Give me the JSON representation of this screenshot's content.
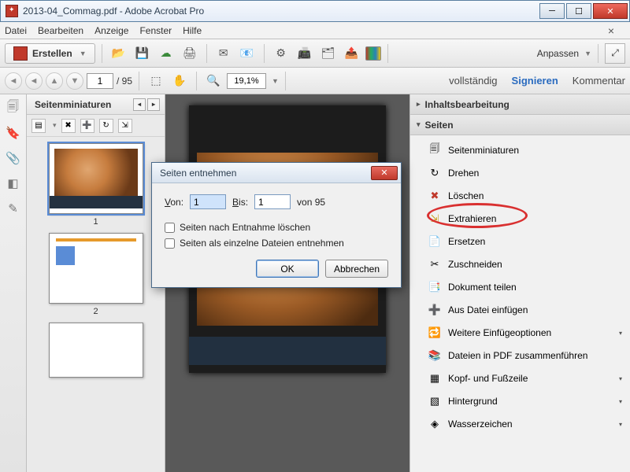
{
  "window": {
    "title": "2013-04_Commag.pdf - Adobe Acrobat Pro"
  },
  "menubar": {
    "items": [
      "Datei",
      "Bearbeiten",
      "Anzeige",
      "Fenster",
      "Hilfe"
    ]
  },
  "toolbar": {
    "create": "Erstellen",
    "anpassen": "Anpassen"
  },
  "nav": {
    "page": "1",
    "total": "/  95",
    "zoom": "19,1%"
  },
  "right_tabs": {
    "tools": "vollständig",
    "sign": "Signieren",
    "comment": "Kommentar"
  },
  "thumbnails": {
    "title": "Seitenminiaturen",
    "pages": [
      "1",
      "2"
    ]
  },
  "rightpanel": {
    "section1": "Inhaltsbearbeitung",
    "section2": "Seiten",
    "items": [
      "Seitenminiaturen",
      "Drehen",
      "Löschen",
      "Extrahieren",
      "Ersetzen",
      "Zuschneiden",
      "Dokument teilen",
      "Aus Datei einfügen",
      "Weitere Einfügeoptionen",
      "Dateien in PDF zusammenführen",
      "Kopf- und Fußzeile",
      "Hintergrund",
      "Wasserzeichen"
    ]
  },
  "dialog": {
    "title": "Seiten entnehmen",
    "von": "Von:",
    "von_val": "1",
    "bis": "Bis:",
    "bis_val": "1",
    "of": "von 95",
    "check1": "Seiten nach Entnahme löschen",
    "check2": "Seiten als einzelne Dateien entnehmen",
    "ok": "OK",
    "cancel": "Abbrechen"
  }
}
